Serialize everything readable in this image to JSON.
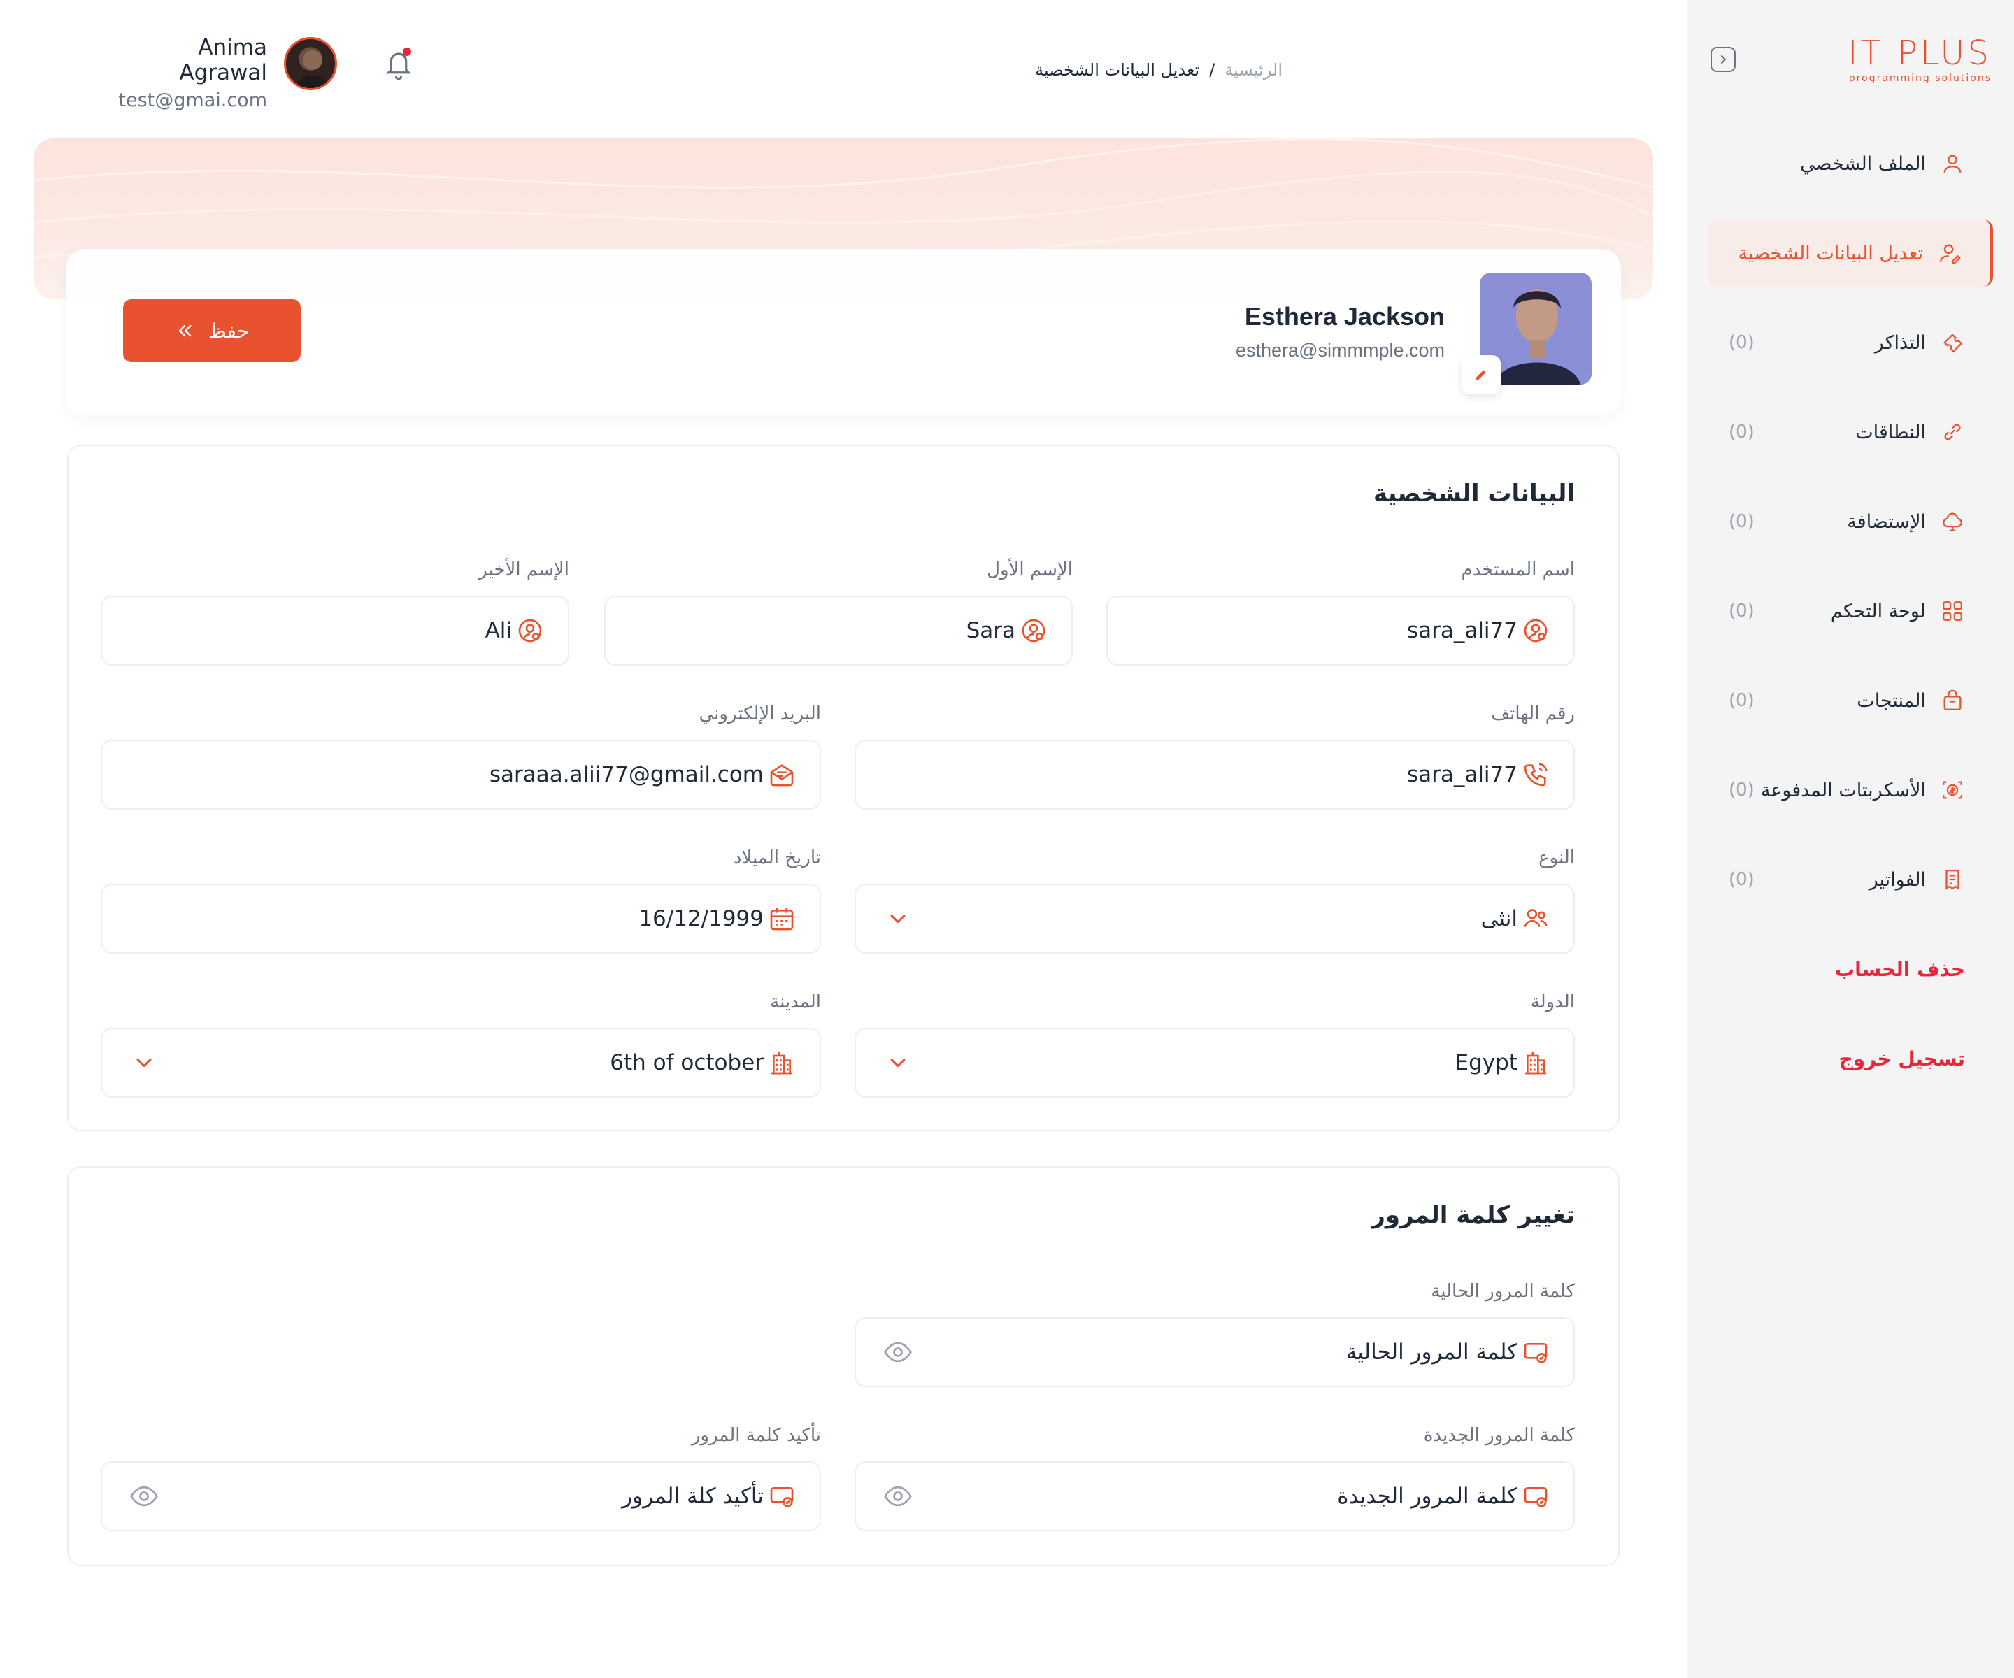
{
  "brand": {
    "name": "IT PLUS",
    "tagline": "programming solutions"
  },
  "sidebar": {
    "items": [
      {
        "label": "الملف الشخصي",
        "count": "",
        "icon": "user-icon",
        "active": false
      },
      {
        "label": "تعديل البيانات الشخصية",
        "count": "",
        "icon": "user-edit-icon",
        "active": true
      },
      {
        "label": "التذاكر",
        "count": "(0)",
        "icon": "ticket-icon",
        "active": false
      },
      {
        "label": "النطاقات",
        "count": "(0)",
        "icon": "link-icon",
        "active": false
      },
      {
        "label": "الإستضافة",
        "count": "(0)",
        "icon": "cloud-icon",
        "active": false
      },
      {
        "label": "لوحة التحكم",
        "count": "(0)",
        "icon": "grid-icon",
        "active": false
      },
      {
        "label": "المنتجات",
        "count": "(0)",
        "icon": "bag-icon",
        "active": false
      },
      {
        "label": "الأسكربتات المدفوعة",
        "count": "(0)",
        "icon": "dollar-scan-icon",
        "active": false
      },
      {
        "label": "الفواتير",
        "count": "(0)",
        "icon": "receipt-icon",
        "active": false
      }
    ],
    "delete_account": "حذف الحساب",
    "logout": "تسجيل خروج"
  },
  "header": {
    "user_name": "Anima Agrawal",
    "user_email": "test@gmai.com",
    "breadcrumb_home": "الرئيسية",
    "breadcrumb_sep": "/",
    "breadcrumb_current": "تعديل البيانات الشخصية"
  },
  "profile": {
    "name": "Esthera Jackson",
    "email": "esthera@simmmple.com",
    "save_label": "حفظ"
  },
  "personal": {
    "title": "البيانات الشخصية",
    "username_label": "اسم المستخدم",
    "username": "sara_ali77",
    "first_name_label": "الإسم الأول",
    "first_name": "Sara",
    "last_name_label": "الإسم الأخير",
    "last_name": "Ali",
    "phone_label": "رقم الهاتف",
    "phone": "sara_ali77",
    "email_label": "البريد الإلكتروني",
    "email": "saraaa.alii77@gmail.com",
    "gender_label": "النوع",
    "gender": "انثى",
    "birthdate_label": "تاريخ الميلاد",
    "birthdate": "16/12/1999",
    "country_label": "الدولة",
    "country": "Egypt",
    "city_label": "المدينة",
    "city": "6th of october"
  },
  "password": {
    "title": "تغيير كلمة المرور",
    "current_label": "كلمة المرور الحالية",
    "current_placeholder": "كلمة المرور الحالية",
    "new_label": "كلمة المرور الجديدة",
    "new_placeholder": "كلمة المرور الجديدة",
    "confirm_label": "تأكيد كلمة المرور",
    "confirm_placeholder": "تأكيد كلة المرور"
  },
  "colors": {
    "accent": "#e8522f",
    "danger": "#e8253a",
    "sidebar_bg": "#f4f4f5"
  }
}
